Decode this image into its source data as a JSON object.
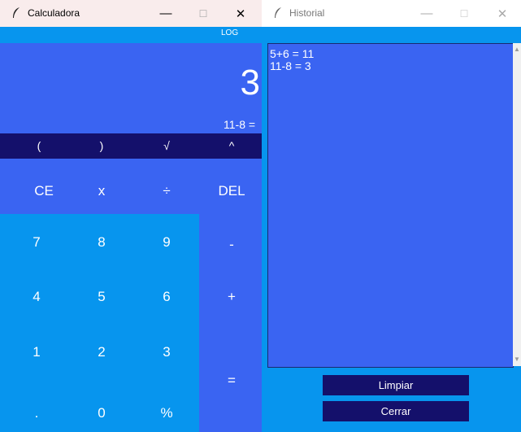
{
  "calculator": {
    "title": "Calculadora",
    "controls": {
      "minimize": "—",
      "maximize": "☐",
      "close": "✕"
    },
    "log_label": "LOG",
    "display": "3",
    "expression": "11-8 =",
    "ops_row": [
      "(",
      ")",
      "√",
      "^"
    ],
    "keys": {
      "ce": "CE",
      "x": "x",
      "div": "÷",
      "del": "DEL",
      "k7": "7",
      "k8": "8",
      "k9": "9",
      "minus": "-",
      "k4": "4",
      "k5": "5",
      "k6": "6",
      "plus": "+",
      "k1": "1",
      "k2": "2",
      "k3": "3",
      "equals": "=",
      "dot": ".",
      "k0": "0",
      "percent": "%"
    }
  },
  "history": {
    "title": "Historial",
    "controls": {
      "minimize": "—",
      "maximize": "☐",
      "close": "✕"
    },
    "entries": [
      "5+6 = 11",
      "11-8 = 3"
    ],
    "clear_label": "Limpiar",
    "close_label": "Cerrar"
  },
  "colors": {
    "primary_blue": "#3a64f2",
    "light_blue": "#0795ee",
    "dark_navy": "#14106b"
  }
}
